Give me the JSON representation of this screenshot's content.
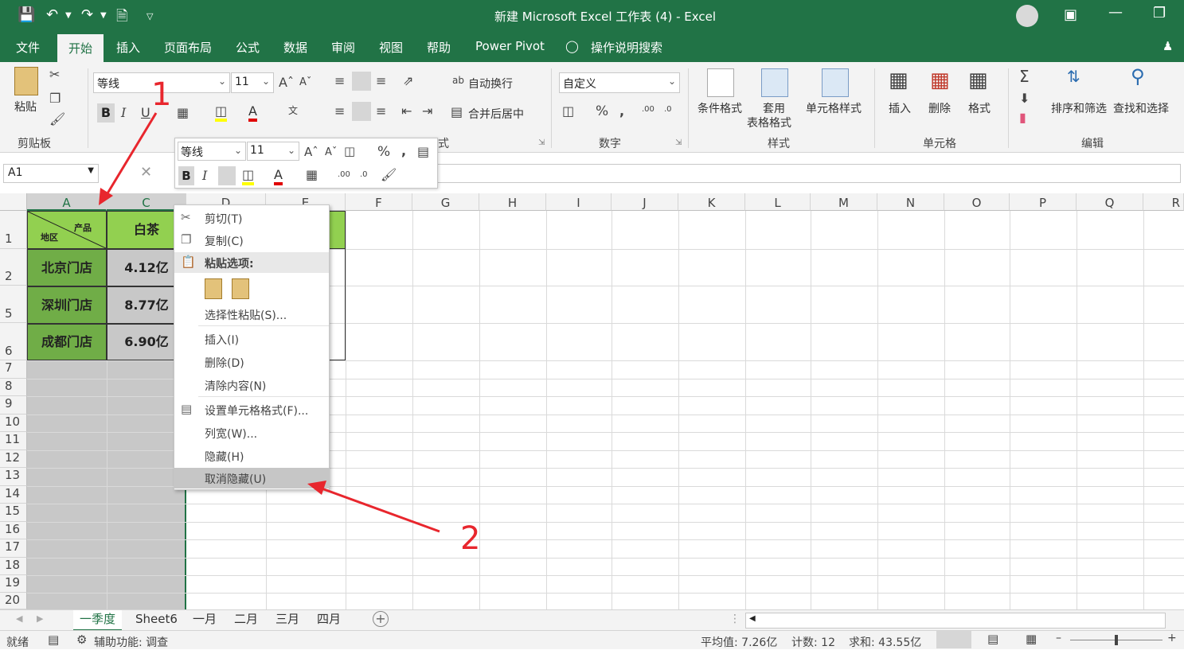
{
  "window": {
    "title": "新建 Microsoft Excel 工作表 (4)  -  Excel"
  },
  "menu_tabs": [
    "文件",
    "开始",
    "插入",
    "页面布局",
    "公式",
    "数据",
    "审阅",
    "视图",
    "帮助",
    "Power Pivot"
  ],
  "search_hint": "操作说明搜索",
  "ribbon": {
    "paste_label": "粘贴",
    "clipboard_group": "剪贴板",
    "font_name": "等线",
    "font_size": "11",
    "bold": "B",
    "italic": "I",
    "underline": "U",
    "wrap_text": "自动换行",
    "merge_center": "合并后居中",
    "align_group_partial": "式",
    "number_format": "自定义",
    "number_group": "数字",
    "conditional_format": "条件格式",
    "table_format_l1": "套用",
    "table_format_l2": "表格格式",
    "cell_styles": "单元格样式",
    "styles_group": "样式",
    "insert": "插入",
    "delete": "删除",
    "format": "格式",
    "cells_group": "单元格",
    "sort_filter": "排序和筛选",
    "find_select": "查找和选择",
    "editing_group": "编辑"
  },
  "name_box": "A1",
  "mini_toolbar": {
    "font_name": "等线",
    "font_size": "11"
  },
  "columns": [
    "A",
    "C",
    "D",
    "E",
    "F",
    "G",
    "H",
    "I",
    "J",
    "K",
    "L",
    "M",
    "N",
    "O",
    "P",
    "Q",
    "R"
  ],
  "rows": [
    "1",
    "2",
    "5",
    "6",
    "7",
    "8",
    "9",
    "10",
    "11",
    "12",
    "13",
    "14",
    "15",
    "16",
    "17",
    "18",
    "19",
    "20"
  ],
  "table": {
    "header_product": "产品",
    "header_region": "地区",
    "header_col_c": "白茶",
    "stores": [
      "北京门店",
      "深圳门店",
      "成都门店"
    ],
    "values_c": [
      "4.12亿",
      "8.77亿",
      "6.90亿"
    ]
  },
  "context_menu": {
    "cut": "剪切(T)",
    "copy": "复制(C)",
    "paste_options": "粘贴选项:",
    "paste_special": "选择性粘贴(S)...",
    "insert": "插入(I)",
    "delete": "删除(D)",
    "clear": "清除内容(N)",
    "format_cells": "设置单元格格式(F)...",
    "col_width": "列宽(W)...",
    "hide": "隐藏(H)",
    "unhide": "取消隐藏(U)"
  },
  "sheets": [
    "一季度",
    "Sheet6",
    "一月",
    "二月",
    "三月",
    "四月"
  ],
  "status": {
    "ready": "就绪",
    "accessibility": "辅助功能: 调查",
    "average": "平均值: 7.26亿",
    "count": "计数: 12",
    "sum": "求和: 43.55亿"
  },
  "annotations": [
    "1",
    "2"
  ],
  "colors": {
    "excel_green": "#217346",
    "header_fill": "#92d050",
    "store_fill": "#70ad47",
    "annotation_red": "#e8262d"
  }
}
